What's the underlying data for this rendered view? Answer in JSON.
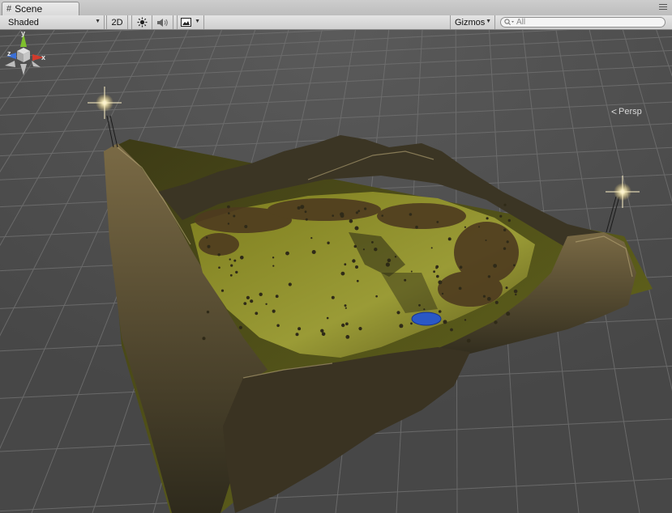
{
  "tab": {
    "title": "Scene",
    "icon": "grid-icon"
  },
  "toolbar": {
    "shading_mode": "Shaded",
    "mode_2d": "2D",
    "gizmos_label": "Gizmos",
    "search_placeholder": "All"
  },
  "viewport": {
    "projection_label": "Persp",
    "gizmo_axes": {
      "x": "x",
      "y": "y",
      "z": "z"
    }
  },
  "colors": {
    "grid_background": "#4b4b4b",
    "grid_line": "#6a6a6a",
    "terrain_grass": "#8c8c2a",
    "terrain_rock": "#3a3322",
    "water": "#2a58c6",
    "axis_x": "#d13b2c",
    "axis_y": "#7ec02c",
    "axis_z": "#3a6fd6"
  }
}
